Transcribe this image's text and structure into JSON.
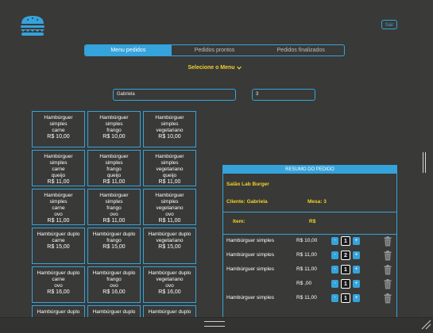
{
  "header": {
    "logout_label": "Sair"
  },
  "tabs": [
    {
      "label": "Menu pedidos",
      "active": true
    },
    {
      "label": "Pedidos prontos",
      "active": false
    },
    {
      "label": "Pedidos finalizados",
      "active": false
    }
  ],
  "menu_selector": {
    "label": "Selecione o Menu"
  },
  "client_input": {
    "value": "Gabriela"
  },
  "table_input": {
    "value": "3"
  },
  "menu_items": [
    {
      "lines": [
        "Hambúrguer",
        "simples",
        "carne"
      ],
      "price": "R$ 10,00"
    },
    {
      "lines": [
        "Hambúrguer",
        "simples",
        "frango"
      ],
      "price": "R$ 10,00"
    },
    {
      "lines": [
        "Hambúrguer",
        "simples",
        "vegetariano"
      ],
      "price": "R$ 10,00"
    },
    {
      "lines": [
        "Hambúrguer",
        "simples",
        "carne",
        "queijo"
      ],
      "price": "R$ 11,00"
    },
    {
      "lines": [
        "Hambúrguer",
        "simples",
        "frango",
        "queijo"
      ],
      "price": "R$ 11,00"
    },
    {
      "lines": [
        "Hambúrguer",
        "simples",
        "vegetariano",
        "queijo"
      ],
      "price": "R$ 11,00"
    },
    {
      "lines": [
        "Hambúrguer",
        "simples",
        "carne",
        "ovo"
      ],
      "price": "R$ 11,00"
    },
    {
      "lines": [
        "Hambúrguer",
        "simples",
        "frango",
        "ovo"
      ],
      "price": "R$ 11,00"
    },
    {
      "lines": [
        "Hambúrguer",
        "simples",
        "vegetariano",
        "ovo"
      ],
      "price": "R$ 11,00"
    },
    {
      "lines": [
        "Hambúrguer duplo",
        "carne"
      ],
      "price": "R$ 15,00"
    },
    {
      "lines": [
        "Hambúrguer duplo",
        "frango"
      ],
      "price": "R$ 15,00"
    },
    {
      "lines": [
        "Hambúrguer duplo",
        "vegetariano"
      ],
      "price": "R$ 15,00"
    },
    {
      "lines": [
        "Hambúrguer duplo",
        "carne",
        "ovo"
      ],
      "price": "R$ 16,00"
    },
    {
      "lines": [
        "Hambúrguer duplo",
        "frango",
        "ovo"
      ],
      "price": "R$ 16,00"
    },
    {
      "lines": [
        "Hambúrguer duplo",
        "vegetariano",
        "ovo"
      ],
      "price": "R$ 16,00"
    },
    {
      "lines": [
        "Hambúrguer duplo"
      ],
      "price": ""
    },
    {
      "lines": [
        "Hambúrguer duplo"
      ],
      "price": ""
    },
    {
      "lines": [
        "Hambúrguer duplo"
      ],
      "price": ""
    }
  ],
  "summary": {
    "title": "RESUMO DO PEDIDO",
    "restaurant": "Salão Lab Burger",
    "client_label": "Cliente: Gabriela",
    "table_label": "Mesa: 3",
    "item_label": "Item:",
    "total_label": "R$",
    "minus_symbol": "-",
    "plus_symbol": "+",
    "orders": [
      {
        "name": "Hambúrguer simples",
        "price": "R$ 10,00",
        "qty": "1"
      },
      {
        "name": "Hambúrguer simples",
        "price": "R$ 11,00",
        "qty": "2"
      },
      {
        "name": "Hambúrguer simples",
        "price": "R$ 11,00",
        "qty": "1"
      },
      {
        "name": "",
        "price": "R$ ,00",
        "qty": "1"
      },
      {
        "name": "Hambúrguer simples",
        "price": "R$ 11,00",
        "qty": "1"
      }
    ]
  },
  "colors": {
    "accent": "#35a3dc",
    "highlight": "#f2d02b",
    "background": "#393937"
  }
}
